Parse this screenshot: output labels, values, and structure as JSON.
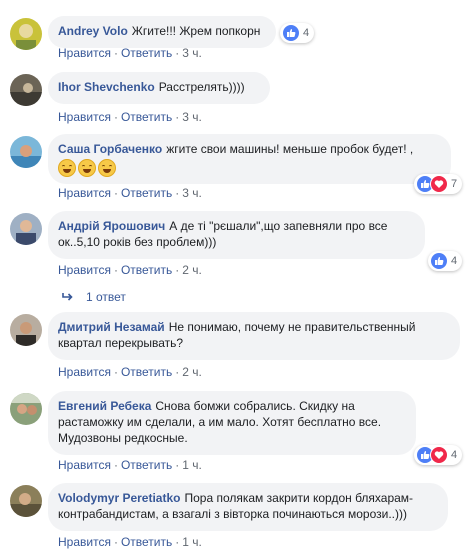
{
  "action_labels": {
    "like": "Нравится",
    "reply": "Ответить",
    "separator": "·"
  },
  "comments": [
    {
      "author": "Andrey Volo",
      "text": "Жгите!!! Жрем попкорн",
      "time": "3 ч.",
      "reactions": {
        "types": [
          "like"
        ],
        "count": "4"
      }
    },
    {
      "author": "Ihor Shevchenko",
      "text": "Расстрелять))))",
      "time": "3 ч."
    },
    {
      "author": "Саша Горбаченко",
      "text": "жгите свои машины! меньше пробок будет! ,",
      "emoji": [
        "grinning-face",
        "grinning-face",
        "grinning-face"
      ],
      "time": "3 ч.",
      "reactions": {
        "types": [
          "like",
          "love"
        ],
        "count": "7"
      }
    },
    {
      "author": "Андрій Ярошович",
      "text": "А де ті \"рєшали\",що запевняли про все ок..5,10 років без проблем)))",
      "time": "2 ч.",
      "reactions": {
        "types": [
          "like"
        ],
        "count": "4"
      }
    },
    {
      "author": "Дмитрий Незамай",
      "text": "Не понимаю, почему не правительственный квартал перекрывать?",
      "time": "2 ч."
    },
    {
      "author": "Евгений Ребека",
      "text": "Снова бомжи собрались. Скидку на растаможку им сделали, а им мало. Хотят бесплатно все. Мудозвоны редкосные.",
      "time": "1 ч.",
      "reactions": {
        "types": [
          "like",
          "love"
        ],
        "count": "4"
      }
    },
    {
      "author": "Volodymyr Peretiatko",
      "text": "Пора полякам закрити кордон бляхарам-контрабандистам, а взагалі з вівторка починаються морози..)))",
      "time": "1 ч."
    }
  ],
  "thread_replies": {
    "label": "1 ответ"
  },
  "colors": {
    "link": "#385898",
    "bubble": "#f2f3f5",
    "like": "#4e7ff7",
    "love": "#f0284a"
  }
}
